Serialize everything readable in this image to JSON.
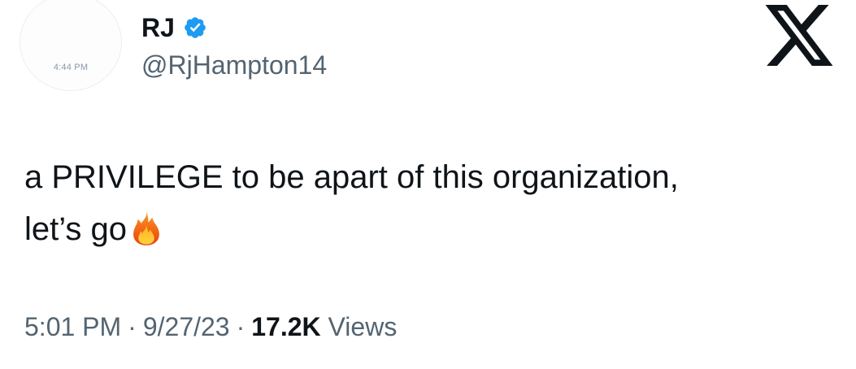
{
  "tweet": {
    "avatar_time": "4:44 PM",
    "display_name": "RJ",
    "handle": "@RjHampton14",
    "text_line_1": "a PRIVILEGE to be apart of this organization,",
    "text_line_2": "let’s go",
    "emoji": "fire-icon",
    "time": "5:01 PM",
    "separator": "·",
    "date": "9/27/23",
    "views_count": "17.2K",
    "views_label": "Views"
  },
  "icons": {
    "verified": "verified-badge-icon",
    "logo": "x-logo-icon"
  },
  "colors": {
    "text_primary": "#0f1419",
    "text_secondary": "#536471",
    "verified_blue": "#1d9bf0",
    "background": "#ffffff"
  }
}
